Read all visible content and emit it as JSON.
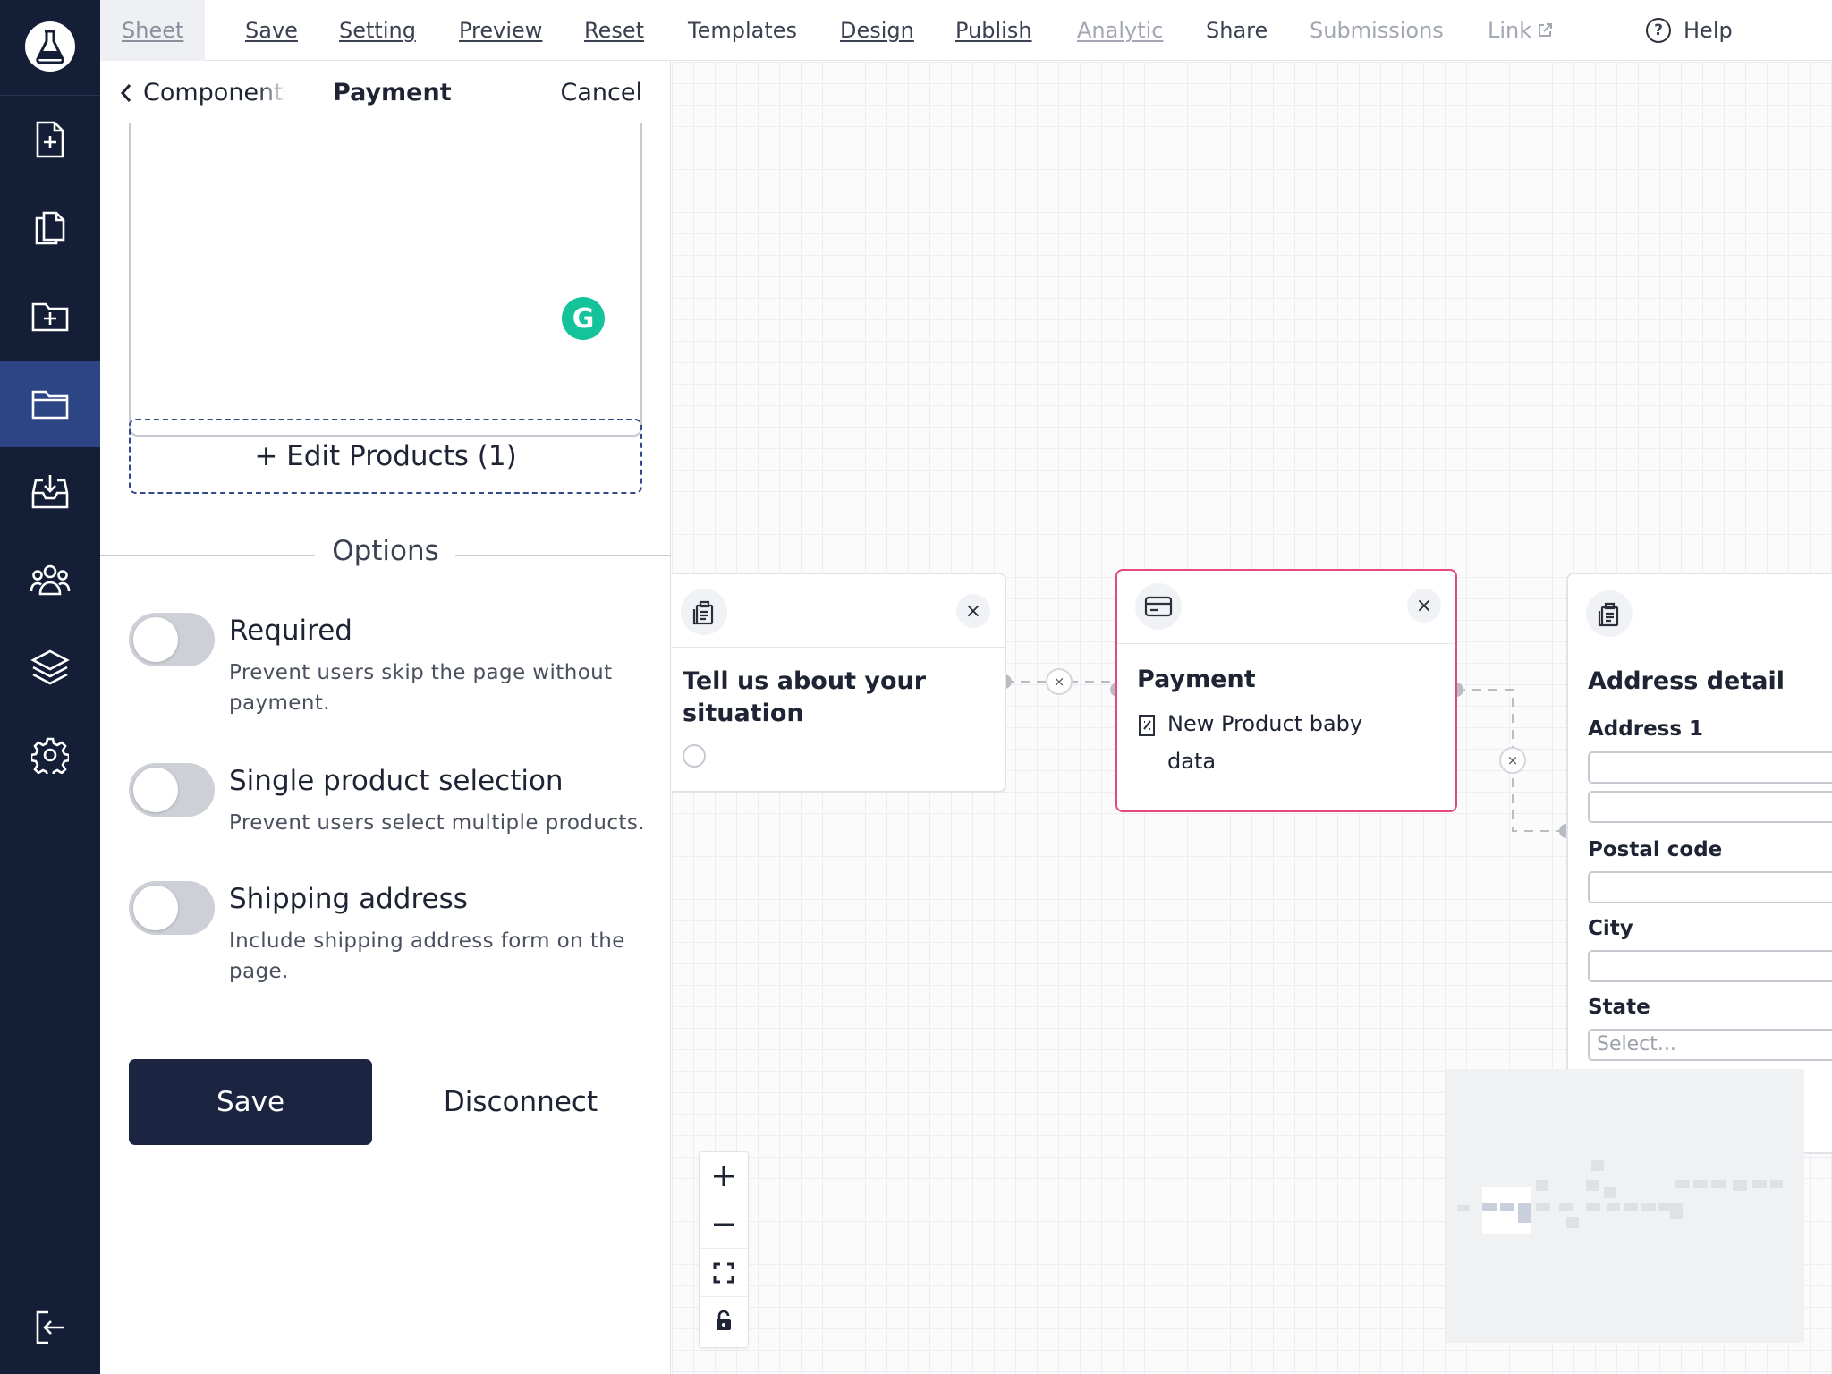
{
  "topbar": {
    "menu": [
      {
        "label": "Sheet",
        "state": "current"
      },
      {
        "label": "Save"
      },
      {
        "label": "Setting"
      },
      {
        "label": "Preview"
      },
      {
        "label": "Reset"
      },
      {
        "label": "Templates"
      },
      {
        "label": "Design"
      },
      {
        "label": "Publish"
      },
      {
        "label": "Analytic",
        "state": "disabled"
      },
      {
        "label": "Share"
      },
      {
        "label": "Submissions",
        "state": "disabled"
      },
      {
        "label": "Link",
        "state": "disabled"
      }
    ],
    "help_label": "Help",
    "help_icon_glyph": "?"
  },
  "sidebar": {
    "icons": [
      "logo-flask-icon",
      "add-file-icon",
      "copy-file-icon",
      "add-folder-icon",
      "folder-icon",
      "inbox-icon",
      "users-icon",
      "layers-icon",
      "gear-icon",
      "logout-icon"
    ],
    "active": "folder-icon"
  },
  "panel": {
    "back_label": "Components",
    "title": "Payment",
    "cancel_label": "Cancel",
    "grammarly_glyph": "G",
    "edit_products_label": "+ Edit Products (1)",
    "options_heading": "Options",
    "options": [
      {
        "title": "Required",
        "description": "Prevent users skip the page without payment.",
        "enabled": false
      },
      {
        "title": "Single product selection",
        "description": "Prevent users select multiple products.",
        "enabled": false
      },
      {
        "title": "Shipping address",
        "description": "Include shipping address form on the page.",
        "enabled": false
      }
    ],
    "save_label": "Save",
    "disconnect_label": "Disconnect"
  },
  "canvas": {
    "nodes": {
      "situation": {
        "title": "Tell us about your situation",
        "close_glyph": "×"
      },
      "payment": {
        "title": "Payment",
        "product": "New Product baby data",
        "close_glyph": "×"
      },
      "address": {
        "title": "Address detail",
        "fields": {
          "address1": "Address 1",
          "postal": "Postal code",
          "city": "City",
          "state": "State"
        },
        "state_placeholder": "Select..."
      }
    },
    "edge_remove_glyph": "×"
  },
  "colors": {
    "rail_bg": "#141e36",
    "rail_active": "#2e4585",
    "selected_border": "#e54a7e",
    "save_button": "#1b2542",
    "grammarly": "#15c39a"
  }
}
